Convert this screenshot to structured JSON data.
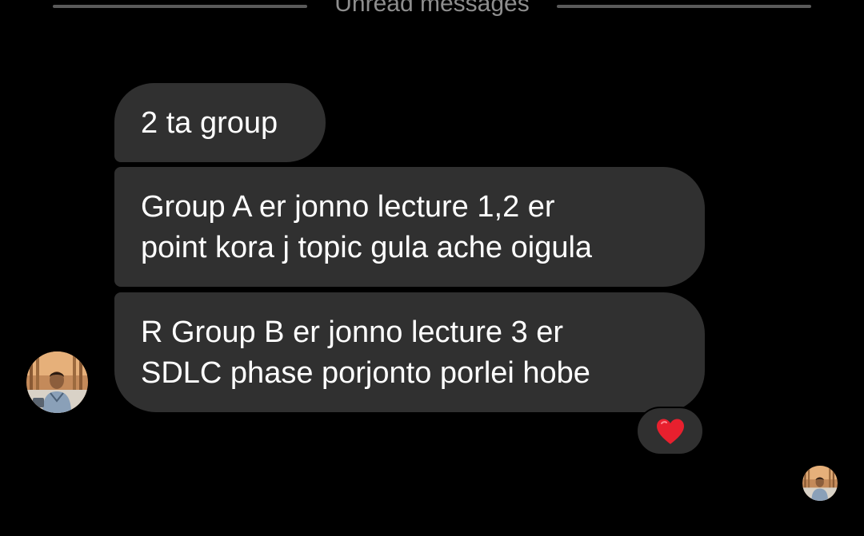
{
  "divider": {
    "label": "Unread messages"
  },
  "messages": [
    {
      "lines": [
        "2 ta group"
      ]
    },
    {
      "lines": [
        "Group A er jonno lecture 1,2 er",
        "point kora j topic gula ache oigula"
      ]
    },
    {
      "lines": [
        "R Group B er jonno lecture 3 er",
        "SDLC phase porjonto porlei hobe"
      ]
    }
  ],
  "reaction": {
    "icon": "heart-icon",
    "color": "#e8202e"
  },
  "colors": {
    "background": "#000000",
    "bubble": "#303030",
    "divider_text": "#8e8e8e",
    "divider_line": "#5a5a5a"
  }
}
